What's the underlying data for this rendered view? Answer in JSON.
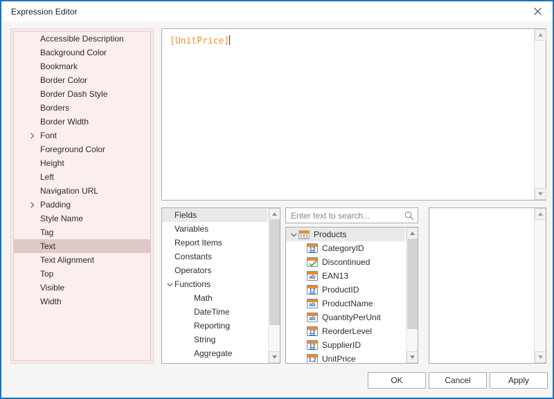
{
  "window": {
    "title": "Expression Editor",
    "close_icon": "close-icon",
    "border_color": "#1e72b8"
  },
  "properties_panel": {
    "background_color": "#fbeeed",
    "selected": "Text",
    "items": [
      {
        "label": "Accessible Description",
        "expandable": false
      },
      {
        "label": "Background Color",
        "expandable": false
      },
      {
        "label": "Bookmark",
        "expandable": false
      },
      {
        "label": "Border Color",
        "expandable": false
      },
      {
        "label": "Border Dash Style",
        "expandable": false
      },
      {
        "label": "Borders",
        "expandable": false
      },
      {
        "label": "Border Width",
        "expandable": false
      },
      {
        "label": "Font",
        "expandable": true
      },
      {
        "label": "Foreground Color",
        "expandable": false
      },
      {
        "label": "Height",
        "expandable": false
      },
      {
        "label": "Left",
        "expandable": false
      },
      {
        "label": "Navigation URL",
        "expandable": false
      },
      {
        "label": "Padding",
        "expandable": true
      },
      {
        "label": "Style Name",
        "expandable": false
      },
      {
        "label": "Tag",
        "expandable": false
      },
      {
        "label": "Text",
        "expandable": false
      },
      {
        "label": "Text Alignment",
        "expandable": false
      },
      {
        "label": "Top",
        "expandable": false
      },
      {
        "label": "Visible",
        "expandable": false
      },
      {
        "label": "Width",
        "expandable": false
      }
    ]
  },
  "expression_editor": {
    "value": "[UnitPrice]",
    "text_color": "#f0903a"
  },
  "category_list": {
    "selected": "Fields",
    "items": [
      {
        "label": "Fields",
        "level": 0,
        "expandable": false
      },
      {
        "label": "Variables",
        "level": 0,
        "expandable": false
      },
      {
        "label": "Report Items",
        "level": 0,
        "expandable": false
      },
      {
        "label": "Constants",
        "level": 0,
        "expandable": false
      },
      {
        "label": "Operators",
        "level": 0,
        "expandable": false
      },
      {
        "label": "Functions",
        "level": 0,
        "expandable": true
      },
      {
        "label": "Math",
        "level": 1,
        "expandable": false
      },
      {
        "label": "DateTime",
        "level": 1,
        "expandable": false
      },
      {
        "label": "Reporting",
        "level": 1,
        "expandable": false
      },
      {
        "label": "String",
        "level": 1,
        "expandable": false
      },
      {
        "label": "Aggregate",
        "level": 1,
        "expandable": false
      }
    ]
  },
  "search": {
    "placeholder": "Enter text to search...",
    "value": "",
    "icon": "search-icon"
  },
  "fields_tree": {
    "root": {
      "label": "Products",
      "icon": "table-icon",
      "expanded": true
    },
    "fields": [
      {
        "label": "CategoryID",
        "icon": "integer-icon",
        "glyph": "12"
      },
      {
        "label": "Discontinued",
        "icon": "boolean-icon",
        "glyph": "check"
      },
      {
        "label": "EAN13",
        "icon": "string-icon",
        "glyph": "ab"
      },
      {
        "label": "ProductID",
        "icon": "integer-icon",
        "glyph": "12"
      },
      {
        "label": "ProductName",
        "icon": "string-icon",
        "glyph": "ab"
      },
      {
        "label": "QuantityPerUnit",
        "icon": "string-icon",
        "glyph": "ab"
      },
      {
        "label": "ReorderLevel",
        "icon": "integer-icon",
        "glyph": "12"
      },
      {
        "label": "SupplierID",
        "icon": "integer-icon",
        "glyph": "12"
      },
      {
        "label": "UnitPrice",
        "icon": "decimal-icon",
        "glyph": "1,2"
      }
    ]
  },
  "description_panel": {
    "text": ""
  },
  "buttons": {
    "ok": "OK",
    "cancel": "Cancel",
    "apply": "Apply"
  }
}
